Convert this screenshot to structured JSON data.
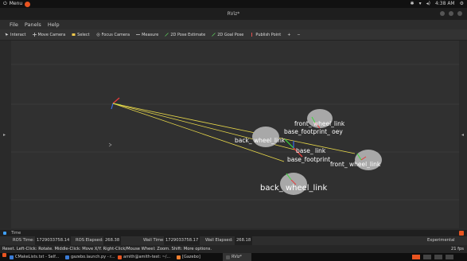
{
  "topbar": {
    "menu_label": "Menu",
    "center_title": "",
    "tray_time": "4:38 AM"
  },
  "window": {
    "title": "RViz*"
  },
  "menubar": {
    "items": [
      "File",
      "Panels",
      "Help"
    ]
  },
  "toolbar": {
    "tools": [
      {
        "label": "Interact",
        "icon": "interact-icon",
        "color": "#e0e0e0"
      },
      {
        "label": "Move Camera",
        "icon": "move-camera-icon",
        "color": "#cfcfcf"
      },
      {
        "label": "Select",
        "icon": "select-icon",
        "color": "#f2c94c"
      },
      {
        "label": "Focus Camera",
        "icon": "focus-camera-icon",
        "color": "#cfcfcf"
      },
      {
        "label": "Measure",
        "icon": "measure-icon",
        "color": "#cfcfcf"
      },
      {
        "label": "2D Pose Estimate",
        "icon": "pose-estimate-icon",
        "color": "#5ccf5c"
      },
      {
        "label": "2D Goal Pose",
        "icon": "goal-pose-icon",
        "color": "#5ccf5c"
      },
      {
        "label": "Publish Point",
        "icon": "publish-point-icon",
        "color": "#e05050"
      },
      {
        "label": "+",
        "icon": "add-tool-icon",
        "color": "#cfcfcf"
      },
      {
        "label": "−",
        "icon": "remove-tool-icon",
        "color": "#cfcfcf"
      }
    ]
  },
  "viewport": {
    "labels": {
      "front_wheel_top": "front_ wheel_link",
      "base_footprint_top": "base_footprint_ oey",
      "back_wheel_top": "back_ wheel_link",
      "base_link": "base_ link",
      "base_footprint": "base_footprint",
      "front_wheel_bottom": "front_ wheel_link",
      "back_wheel_bottom": "back_ wheel_link"
    },
    "colors": {
      "link_line": "#e8d84a",
      "axis_x": "#e33b3b",
      "axis_y": "#3bd93b",
      "axis_z": "#3b6de3",
      "wheel": "#a8a8a8"
    }
  },
  "time_panel": {
    "title": "Time",
    "ros_time_label": "ROS Time:",
    "ros_time": "1729033758.14",
    "ros_elapsed_label": "ROS Elapsed:",
    "ros_elapsed": "268.38",
    "wall_time_label": "Wall Time:",
    "wall_time": "1729033758.17",
    "wall_elapsed_label": "Wall Elapsed:",
    "wall_elapsed": "268.18",
    "mode": "Experimental"
  },
  "status": {
    "reset_label": "Reset",
    "text": "Left-Click: Rotate. Middle-Click: Move X/Y. Right-Click/Mouse Wheel: Zoom. Shift: More options.",
    "fps": "21 fps"
  },
  "taskbar": {
    "tasks": [
      {
        "label": "CMakeLists.txt - Self...",
        "color": "#3a7bd5"
      },
      {
        "label": "gazebo.launch.py - r...",
        "color": "#3a7bd5"
      },
      {
        "label": "amith@amith-test: ~/...",
        "color": "#e95420"
      },
      {
        "label": "[Gazebo]",
        "color": "#f08030"
      },
      {
        "label": "RViz*",
        "color": "#4a4a4a"
      }
    ]
  }
}
